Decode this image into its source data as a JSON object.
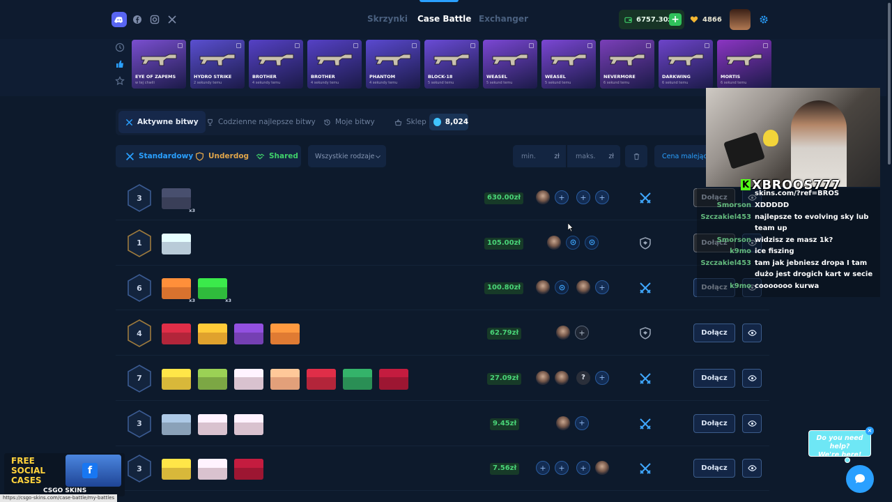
{
  "nav": {
    "links": [
      {
        "label": "Skrzynki",
        "active": false
      },
      {
        "label": "Case Battle",
        "active": true
      },
      {
        "label": "Exchanger",
        "active": false
      }
    ],
    "socials": [
      "discord-icon",
      "facebook-icon",
      "instagram-icon",
      "x-icon"
    ],
    "balance": "6757.30zł",
    "coins": "4866"
  },
  "drops": [
    {
      "name": "EYE OF ZAPEMS",
      "time": "w tej chwili",
      "color": "#7a4fd0"
    },
    {
      "name": "HYDRO STRIKE",
      "time": "2 sekundy temu",
      "color": "#5a4fd0"
    },
    {
      "name": "BROTHER",
      "time": "4 sekundy temu",
      "color": "#5541c5"
    },
    {
      "name": "BROTHER",
      "time": "4 sekundy temu",
      "color": "#5541c5"
    },
    {
      "name": "PHANTOM",
      "time": "4 sekundy temu",
      "color": "#5a49cf"
    },
    {
      "name": "BLOCK-18",
      "time": "5 sekund temu",
      "color": "#6a4bd6"
    },
    {
      "name": "WEASEL",
      "time": "5 sekund temu",
      "color": "#7b47d4"
    },
    {
      "name": "WEASEL",
      "time": "5 sekund temu",
      "color": "#7b47d4"
    },
    {
      "name": "NEVERMORE",
      "time": "6 sekund temu",
      "color": "#7a3fb8"
    },
    {
      "name": "DARKWING",
      "time": "6 sekund temu",
      "color": "#6d44c9"
    },
    {
      "name": "MORTIS",
      "time": "6 sekund temu",
      "color": "#8b35c2"
    }
  ],
  "tabs": {
    "active_battles": "Aktywne bitwy",
    "daily_best": "Codzienne najlepsze bitwy",
    "my_battles": "Moje bitwy",
    "shop": "Sklep",
    "gems": "8,024"
  },
  "filters": {
    "standard": "Standardowy",
    "underdog": "Underdog",
    "shared": "Shared",
    "all_types": "Wszystkie rodzaje",
    "min": "min.",
    "max": "maks.",
    "currency": "zł",
    "sort": "Cena malejąco"
  },
  "battles": [
    {
      "rounds": "3",
      "price": "630.00zł",
      "mode": "standard",
      "hex": "#3b5b92",
      "cases": [
        {
          "color": "#3a3f58",
          "count": "x3"
        }
      ],
      "slots": [
        "face",
        "plus",
        "plus",
        "plus"
      ],
      "join": "Dołącz"
    },
    {
      "rounds": "1",
      "price": "105.00zł",
      "mode": "underdog",
      "hex": "#9d7a3d",
      "cases": [
        {
          "color": "#b9cbd8",
          "count": ""
        }
      ],
      "slots": [
        "face",
        "target",
        "target"
      ],
      "join": "Dołącz"
    },
    {
      "rounds": "6",
      "price": "100.80zł",
      "mode": "standard",
      "hex": "#3b5b92",
      "cases": [
        {
          "color": "#d8722e",
          "count": "x3"
        },
        {
          "color": "#2fbb3c",
          "count": "x3"
        }
      ],
      "slots": [
        "face",
        "target",
        "face",
        "plus"
      ],
      "join": "Dołącz"
    },
    {
      "rounds": "4",
      "price": "62.79zł",
      "mode": "underdog",
      "hex": "#9d7a3d",
      "cases": [
        {
          "color": "#b3253a",
          "count": ""
        },
        {
          "color": "#e0a22d",
          "count": ""
        },
        {
          "color": "#7540b3",
          "count": ""
        },
        {
          "color": "#e07b33",
          "count": ""
        }
      ],
      "slots": [
        "face",
        "plus-grey"
      ],
      "join": "Dołącz"
    },
    {
      "rounds": "7",
      "price": "27.09zł",
      "mode": "standard",
      "hex": "#3b5b92",
      "cases": [
        {
          "color": "#d8b83a",
          "count": ""
        },
        {
          "color": "#7ca744",
          "count": ""
        },
        {
          "color": "#d9c2cf",
          "count": ""
        },
        {
          "color": "#e2a07a",
          "count": ""
        },
        {
          "color": "#b3253a",
          "count": ""
        },
        {
          "color": "#2a8f55",
          "count": ""
        },
        {
          "color": "#9d1632",
          "count": ""
        }
      ],
      "slots": [
        "face",
        "face",
        "q",
        "plus"
      ],
      "join": "Dołącz"
    },
    {
      "rounds": "3",
      "price": "9.45zł",
      "mode": "standard",
      "hex": "#3b5b92",
      "cases": [
        {
          "color": "#8aa1b8",
          "count": ""
        },
        {
          "color": "#d9c2cf",
          "count": ""
        },
        {
          "color": "#d9c2cf",
          "count": ""
        }
      ],
      "slots": [
        "face",
        "plus"
      ],
      "join": "Dołącz"
    },
    {
      "rounds": "3",
      "price": "7.56zł",
      "mode": "standard",
      "hex": "#3b5b92",
      "cases": [
        {
          "color": "#d8b83a",
          "count": ""
        },
        {
          "color": "#d9c2cf",
          "count": ""
        },
        {
          "color": "#9d1632",
          "count": ""
        }
      ],
      "slots": [
        "plus",
        "plus",
        "plus",
        "face"
      ],
      "join": "Dołącz"
    }
  ],
  "stream": {
    "channel": "XBROOS777",
    "messages": [
      {
        "user": "",
        "text": "skins.com/?ref=BROS"
      },
      {
        "user": "Smorson",
        "text": "XDDDDD"
      },
      {
        "user": "Szczakiel453",
        "text": "najlepsze to evolving sky lub team up"
      },
      {
        "user": "Smorson",
        "text": "widzisz ze masz 1k?"
      },
      {
        "user": "k9mo",
        "text": "ice fiszing"
      },
      {
        "user": "Szczakiel453",
        "text": "tam jak jebniesz dropa I tam dużo jest drogich kart w secie"
      },
      {
        "user": "k9mo",
        "text": "cooooooo kurwa"
      }
    ]
  },
  "promo": {
    "line1": "FREE",
    "line2": "SOCIAL",
    "line3": "CASES",
    "brand": "CSGO SKINS"
  },
  "status_url": "https://csgo-skins.com/case-battle/my-battles",
  "help": {
    "text1": "Do you need help?",
    "text2": "We're here!"
  }
}
